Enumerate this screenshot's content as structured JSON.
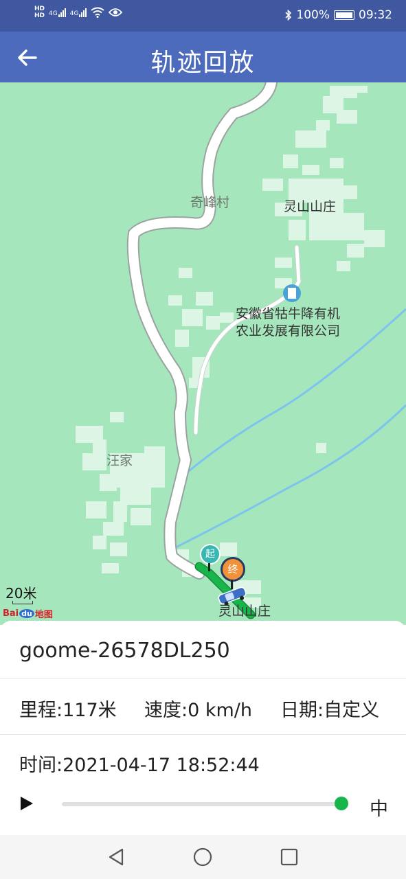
{
  "status_bar": {
    "network": [
      "HD",
      "4G",
      "4G"
    ],
    "battery": "100%",
    "time": "09:32"
  },
  "header": {
    "title": "轨迹回放",
    "back_icon": "arrow-left-icon"
  },
  "map": {
    "labels": {
      "village_qifeng": "奇峰村",
      "lingshan": "灵山山庄",
      "company_line1": "安徽省牯牛降有机",
      "company_line2": "农业发展有限公司",
      "wangjia": "汪家",
      "lingshan_bottom": "灵山山庄"
    },
    "start_marker": "起",
    "end_marker": "终",
    "scale": "20米",
    "logo": {
      "prefix": "Bai",
      "du": "du",
      "suffix": "地图"
    },
    "colors": {
      "land": "#a5e6bd",
      "road": "#ffffff",
      "building": "#dcf5e5",
      "river": "#7ec3ee",
      "track": "#18b54a"
    }
  },
  "info": {
    "device_name": "goome-26578DL250",
    "mileage": "里程:117米",
    "speed": "速度:0 km/h",
    "date": "日期:自定义",
    "time": "时间:2021-04-17 18:52:44",
    "playback_speed": "中",
    "progress_fraction": 1.0
  },
  "nav": {
    "back": "triangle-back-icon",
    "home": "circle-home-icon",
    "recent": "square-recent-icon"
  }
}
